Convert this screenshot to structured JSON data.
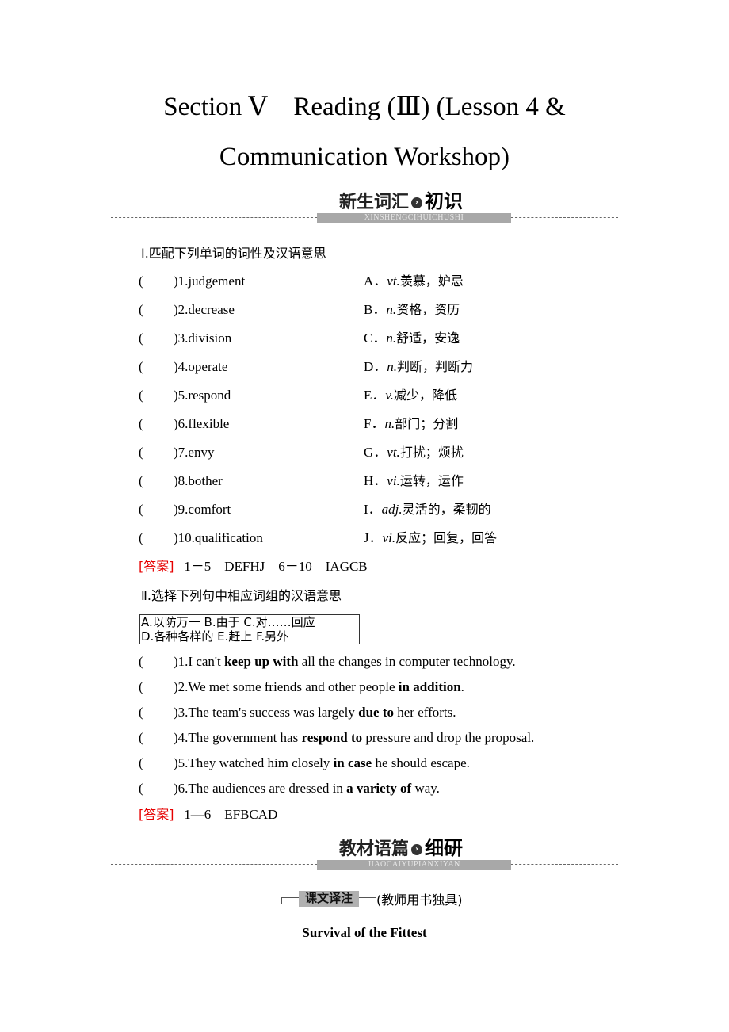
{
  "title": {
    "line1": "Section Ⅴ    Reading (Ⅲ) (Lesson 4 &",
    "line2": "Communication Workshop)"
  },
  "banner1": {
    "heading": "新生词汇",
    "heading_strong": "初识",
    "pinyin": "XINSHENGCIHUICHUSHI",
    "icon": "arrow-right-circle-icon"
  },
  "part1": {
    "heading": "Ⅰ.匹配下列单词的词性及汉语意思",
    "rows": [
      {
        "paren": "(",
        "word": ")1.judgement",
        "letter": "A．",
        "pos": "vt.",
        "meaning": "羡慕，妒忌"
      },
      {
        "paren": "(",
        "word": ")2.decrease",
        "letter": "B．",
        "pos": "n.",
        "meaning": "资格，资历"
      },
      {
        "paren": "(",
        "word": ")3.division",
        "letter": "C．",
        "pos": "n.",
        "meaning": "舒适，安逸"
      },
      {
        "paren": "(",
        "word": ")4.operate",
        "letter": "D．",
        "pos": "n.",
        "meaning": "判断，判断力"
      },
      {
        "paren": "(",
        "word": ")5.respond",
        "letter": "E．",
        "pos": "v.",
        "meaning": "减少，降低"
      },
      {
        "paren": "(",
        "word": ")6.flexible",
        "letter": "F．",
        "pos": "n.",
        "meaning": "部门；分割"
      },
      {
        "paren": "(",
        "word": ")7.envy",
        "letter": "G．",
        "pos": "vt.",
        "meaning": "打扰；烦扰"
      },
      {
        "paren": "(",
        "word": ")8.bother",
        "letter": "H．",
        "pos": "vi.",
        "meaning": "运转，运作"
      },
      {
        "paren": "(",
        "word": ")9.comfort",
        "letter": "I．",
        "pos": "adj.",
        "meaning": "灵活的，柔韧的"
      },
      {
        "paren": "(",
        "word": ")10.qualification",
        "letter": "J．",
        "pos": "vi.",
        "meaning": "反应；回复，回答"
      }
    ],
    "answer_tag": "[答案]",
    "answer_text": "   1－5    DEFHJ    6－10    IAGCB"
  },
  "part2": {
    "heading": "Ⅱ.选择下列句中相应词组的汉语意思",
    "options_line1": "A.以防万一  B.由于  C.对……回应",
    "options_line2": "D.各种各样的  E.赶上  F.另外",
    "sentences": [
      {
        "paren": "(",
        "pre": ")1.I can't ",
        "bold": "keep up with",
        "post": " all the changes in computer technology."
      },
      {
        "paren": "(",
        "pre": ")2.We met some friends and other people ",
        "bold": "in addition",
        "post": "."
      },
      {
        "paren": "(",
        "pre": ")3.The team's success was largely ",
        "bold": "due to",
        "post": " her efforts."
      },
      {
        "paren": "(",
        "pre": ")4.The government has ",
        "bold": "respond to",
        "post": " pressure and drop the proposal."
      },
      {
        "paren": "(",
        "pre": ")5.They watched him closely ",
        "bold": "in case",
        "post": " he should escape."
      },
      {
        "paren": "(",
        "pre": ")6.The audiences are dressed in ",
        "bold": "a variety of",
        "post": " way."
      }
    ],
    "answer_tag": "[答案]",
    "answer_text": "   1—6    EFBCAD"
  },
  "banner2": {
    "heading": "教材语篇",
    "heading_strong": "细研",
    "pinyin": "JIAOCAIYUPIANXIYAN",
    "icon": "arrow-right-circle-icon"
  },
  "note": {
    "label": "课文译注",
    "aside": "(教师用书独具)"
  },
  "passage_title": "Survival of the Fittest"
}
